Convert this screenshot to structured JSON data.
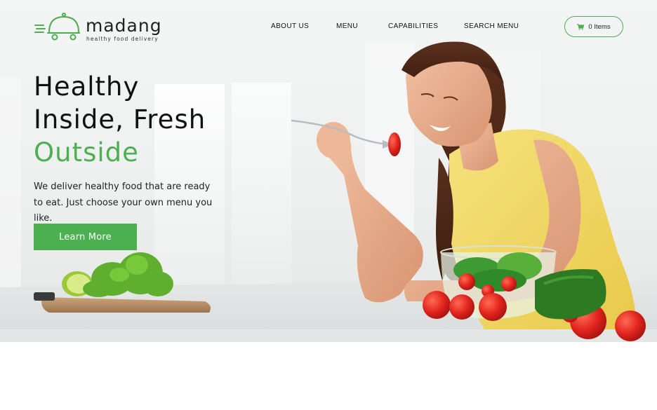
{
  "brand": {
    "name": "madang",
    "tagline": "healthy food delivery",
    "accent": "#4caf50"
  },
  "nav": {
    "items": [
      {
        "label": "ABOUT US"
      },
      {
        "label": "MENU"
      },
      {
        "label": "CAPABILITIES"
      },
      {
        "label": "SEARCH MENU"
      }
    ]
  },
  "cart": {
    "label": "0 Items",
    "icon": "cart-icon"
  },
  "hero": {
    "headline_line1": "Healthy",
    "headline_line2": "Inside, Fresh",
    "headline_line3": "Outside",
    "subtext": "We deliver healthy food that are ready to eat. Just choose your own menu you like.",
    "cta_label": "Learn More"
  }
}
